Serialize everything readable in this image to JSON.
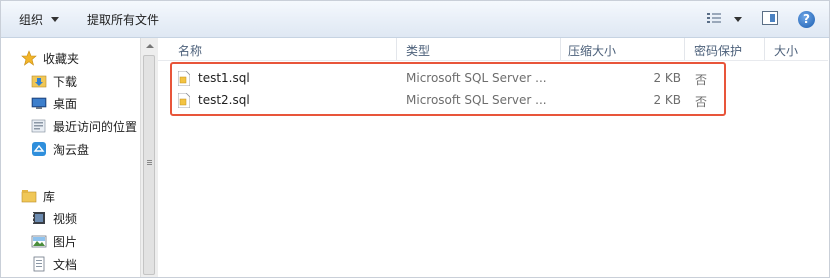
{
  "toolbar": {
    "organize_label": "组织",
    "extract_all_label": "提取所有文件",
    "help_glyph": "?"
  },
  "nav": {
    "favorites": "收藏夹",
    "downloads": "下载",
    "desktop": "桌面",
    "recent": "最近访问的位置",
    "cloud": "淘云盘",
    "library": "库",
    "videos": "视频",
    "pictures": "图片",
    "documents": "文档"
  },
  "columns": {
    "name": "名称",
    "type": "类型",
    "compressed_size": "压缩大小",
    "password": "密码保护",
    "size": "大小"
  },
  "files": [
    {
      "name": "test1.sql",
      "type": "Microsoft SQL Server ...",
      "size": "2 KB",
      "encrypted": "否"
    },
    {
      "name": "test2.sql",
      "type": "Microsoft SQL Server ...",
      "size": "2 KB",
      "encrypted": "否"
    }
  ],
  "colors": {
    "highlight": "#e8553a",
    "toolbar": "#e7eef7"
  }
}
